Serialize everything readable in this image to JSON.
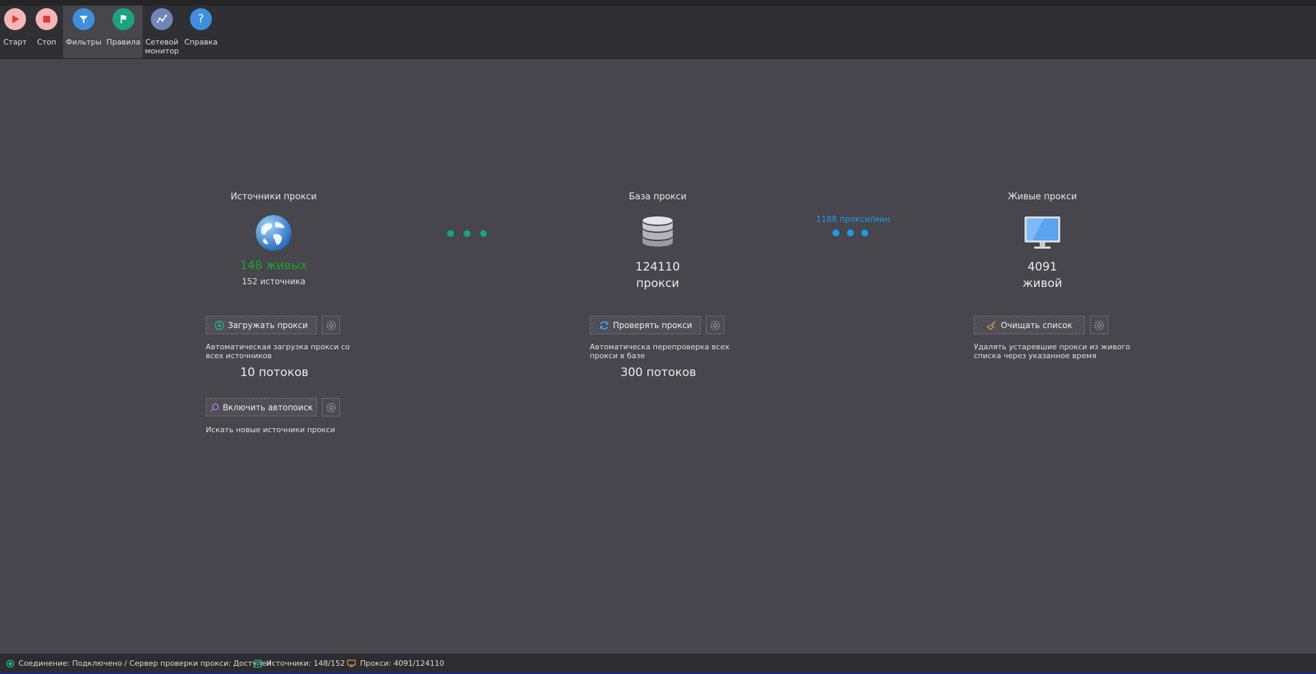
{
  "toolbar": {
    "items": [
      {
        "label": "Старт",
        "icon": "play-icon",
        "color": "#f5b6b6"
      },
      {
        "label": "Стоп",
        "icon": "stop-icon",
        "color": "#f5b6b6"
      },
      {
        "label": "Фильтры",
        "icon": "filter-icon",
        "color": "#3d8fe0"
      },
      {
        "label": "Правила",
        "icon": "flag-icon",
        "color": "#19a37e"
      },
      {
        "label_line1": "Сетевой",
        "label_line2": "монитор",
        "icon": "network-chart-icon",
        "color": "#6f87b8"
      },
      {
        "label": "Справка",
        "icon": "help-icon",
        "color": "#3d8fe0"
      }
    ]
  },
  "sources": {
    "title": "Источники прокси",
    "alive": "148 живых",
    "count": "152 источника",
    "load_button": "Загружать прокси",
    "load_desc_line1": "Автоматическая загрузка прокси со",
    "load_desc_line2": "всех источников",
    "threads": "10 потоков",
    "autosearch_button": "Включить автопоиск",
    "autosearch_desc": "Искать новые источники прокси"
  },
  "database": {
    "title": "База прокси",
    "count": "124110",
    "unit": "прокси",
    "check_button": "Проверять прокси",
    "check_desc_line1": "Автоматическа перепроверка всех",
    "check_desc_line2": "прокси в базе",
    "threads": "300 потоков"
  },
  "rate": "1188 прокси/мин",
  "live": {
    "title": "Живые прокси",
    "count": "4091",
    "unit": "живой",
    "clear_button": "Очищать список",
    "clear_desc_line1": "Удалять устаревшие прокси из живого",
    "clear_desc_line2": "списка через указанное время"
  },
  "status": {
    "connection": "Соединение: Подключено / Сервер проверки прокси: Доступен",
    "sources": "Источники: 148/152",
    "proxies": "Прокси: 4091/124110"
  },
  "colors": {
    "accent_green": "#16a82a",
    "dot_green": "#19a37e",
    "dot_blue": "#1e9be6"
  }
}
